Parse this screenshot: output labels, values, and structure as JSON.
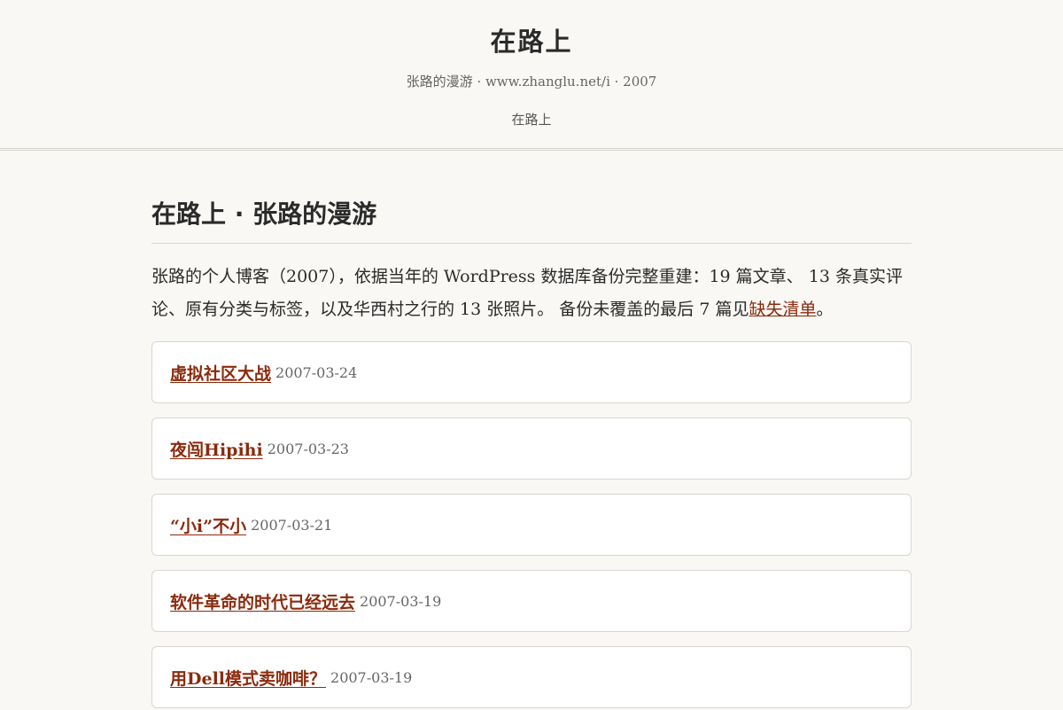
{
  "site": {
    "title": "在路上",
    "subtitle": "张路的漫游 · www.zhanglu.net/i · 2007",
    "nav": [
      "在路上"
    ]
  },
  "page": {
    "title": "在路上 · 张路的漫游",
    "intro_text": "张路的个人博客（2007），依据当年的 WordPress 数据库备份完整重建：19 篇文章、 13 条真实评论、原有分类与标签，以及华西村之行的 13 张照片。 备份未覆盖的最后 7 篇见",
    "intro_link": "缺失清单",
    "intro_end": "。"
  },
  "posts": [
    {
      "title": "虚拟社区大战",
      "date": "2007-03-24"
    },
    {
      "title": "夜闯Hipihi",
      "date": "2007-03-23"
    },
    {
      "title": "“小i”不小",
      "date": "2007-03-21"
    },
    {
      "title": "软件革命的时代已经远去",
      "date": "2007-03-19"
    },
    {
      "title": "用Dell模式卖咖啡？",
      "date": "2007-03-19"
    }
  ],
  "colors": {
    "background": "#f9f8f4",
    "link": "#8b2a0c",
    "card": "#ffffff",
    "border": "#d9d6cf"
  }
}
